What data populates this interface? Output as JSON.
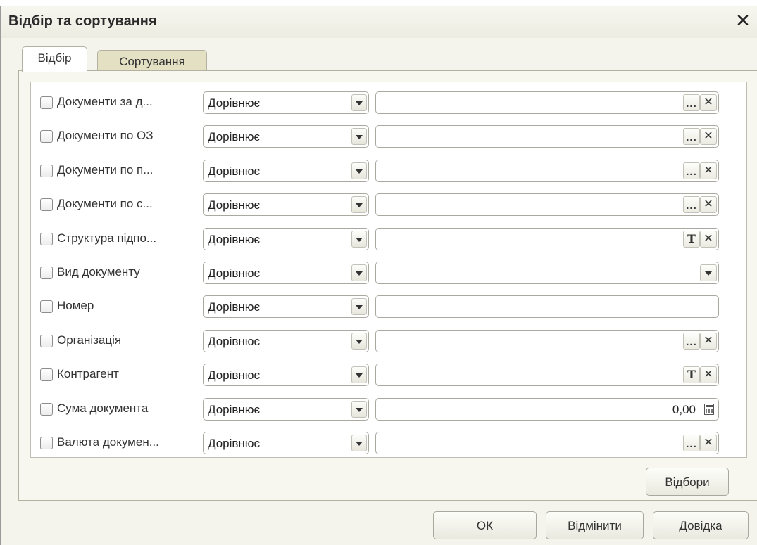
{
  "window": {
    "title": "Відбір та сортування",
    "close_glyph": "✕"
  },
  "tabs": [
    {
      "label": "Відбір",
      "active": true
    },
    {
      "label": "Сортування",
      "active": false
    }
  ],
  "filters": [
    {
      "label": "Документи за д...",
      "comparison": "Дорівнює",
      "value": "",
      "buttons": [
        "ellipsis",
        "clear"
      ]
    },
    {
      "label": "Документи по ОЗ",
      "comparison": "Дорівнює",
      "value": "",
      "buttons": [
        "ellipsis",
        "clear"
      ]
    },
    {
      "label": "Документи по п...",
      "comparison": "Дорівнює",
      "value": "",
      "buttons": [
        "ellipsis",
        "clear"
      ]
    },
    {
      "label": "Документи по с...",
      "comparison": "Дорівнює",
      "value": "",
      "buttons": [
        "ellipsis",
        "clear"
      ]
    },
    {
      "label": "Структура підпо...",
      "comparison": "Дорівнює",
      "value": "",
      "buttons": [
        "type",
        "clear"
      ]
    },
    {
      "label": "Вид документу",
      "comparison": "Дорівнює",
      "value": "",
      "buttons": [
        "dropdown"
      ]
    },
    {
      "label": "Номер",
      "comparison": "Дорівнює",
      "value": "",
      "buttons": []
    },
    {
      "label": "Організація",
      "comparison": "Дорівнює",
      "value": "",
      "buttons": [
        "ellipsis",
        "clear"
      ]
    },
    {
      "label": "Контрагент",
      "comparison": "Дорівнює",
      "value": "",
      "buttons": [
        "type",
        "clear"
      ]
    },
    {
      "label": "Сума документа",
      "comparison": "Дорівнює",
      "value": "0,00",
      "buttons": [
        "calculator"
      ]
    },
    {
      "label": "Валюта докумен...",
      "comparison": "Дорівнює",
      "value": "",
      "buttons": [
        "ellipsis",
        "clear"
      ]
    }
  ],
  "glyphs": {
    "ellipsis": "...",
    "clear": "✕",
    "type": "T"
  },
  "buttons": {
    "filters": "Відбори",
    "ok": "ОК",
    "cancel": "Відмінити",
    "help": "Довідка"
  }
}
